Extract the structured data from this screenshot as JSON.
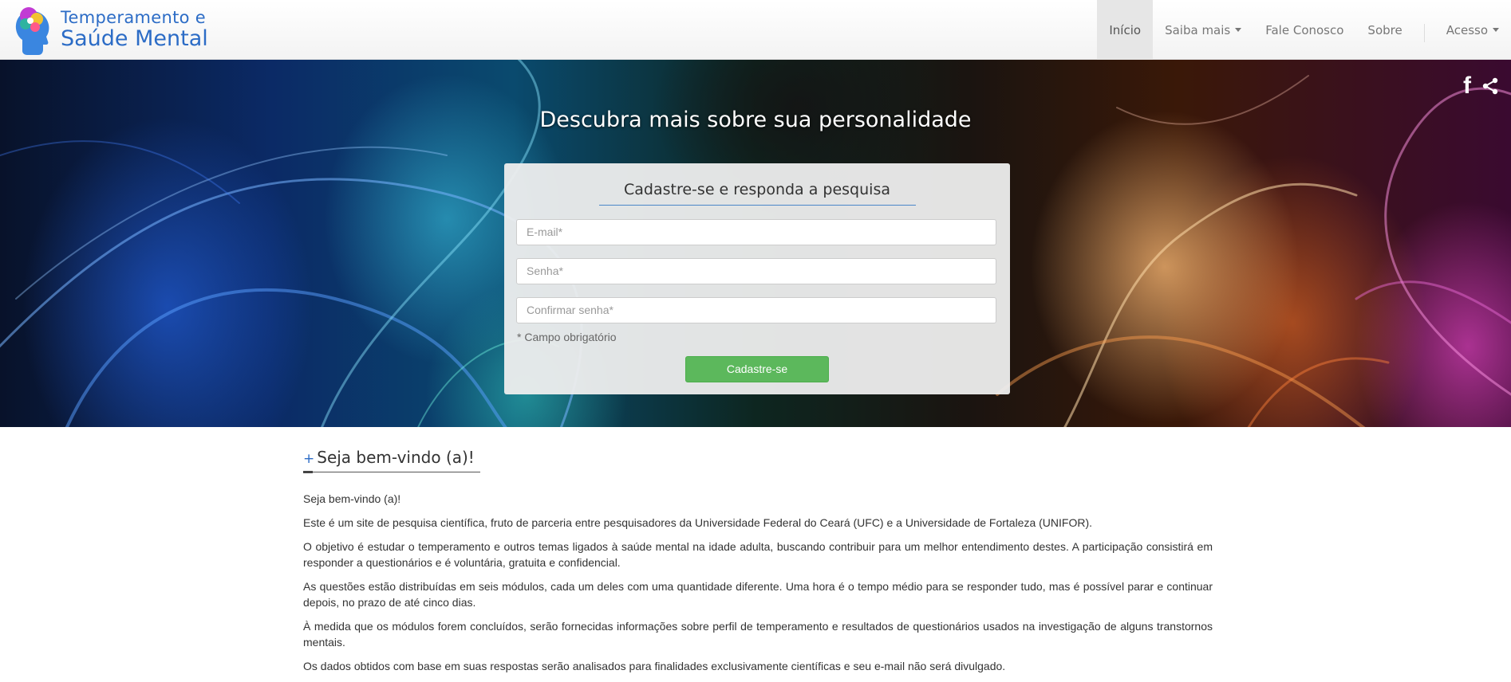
{
  "brand": {
    "line1": "Temperamento e",
    "line2": "Saúde Mental"
  },
  "nav": {
    "items": [
      {
        "label": "Início",
        "active": true,
        "dropdown": false
      },
      {
        "label": "Saiba mais",
        "active": false,
        "dropdown": true
      },
      {
        "label": "Fale Conosco",
        "active": false,
        "dropdown": false
      },
      {
        "label": "Sobre",
        "active": false,
        "dropdown": false
      },
      {
        "label": "Acesso",
        "active": false,
        "dropdown": true
      }
    ]
  },
  "hero": {
    "title": "Descubra mais sobre sua personalidade",
    "social": {
      "facebook_glyph": "f",
      "icons": [
        "facebook-icon",
        "share-icon"
      ]
    }
  },
  "signup": {
    "title": "Cadastre-se e responda a pesquisa",
    "email_placeholder": "E-mail*",
    "password_placeholder": "Senha*",
    "confirm_placeholder": "Confirmar senha*",
    "required_note": "* Campo obrigatório",
    "submit_label": "Cadastre-se"
  },
  "welcome": {
    "plus": "+",
    "heading": "Seja bem-vindo (a)!",
    "paragraphs": [
      "Seja bem-vindo (a)!",
      "Este é um site de pesquisa científica, fruto de parceria entre pesquisadores da Universidade Federal do Ceará (UFC) e a Universidade de Fortaleza (UNIFOR).",
      "O objetivo é estudar o temperamento e outros temas ligados à saúde mental na idade adulta, buscando contribuir para um melhor entendimento destes. A participação consistirá em responder a questionários e é voluntária, gratuita e confidencial.",
      "As questões estão distribuídas em seis módulos, cada um deles com uma quantidade diferente. Uma hora é o tempo médio para se responder tudo, mas é possível parar e continuar depois, no prazo de até cinco dias.",
      "À medida que os módulos forem concluídos, serão fornecidas informações sobre perfil de temperamento e resultados de questionários usados na investigação de alguns transtornos mentais.",
      "Os dados obtidos com base em suas respostas serão analisados para finalidades exclusivamente científicas e seu e-mail não será divulgado."
    ]
  },
  "colors": {
    "brand_blue": "#2c6cc6",
    "submit_green": "#5cb85c",
    "nav_active_bg": "#e6e6e6"
  }
}
